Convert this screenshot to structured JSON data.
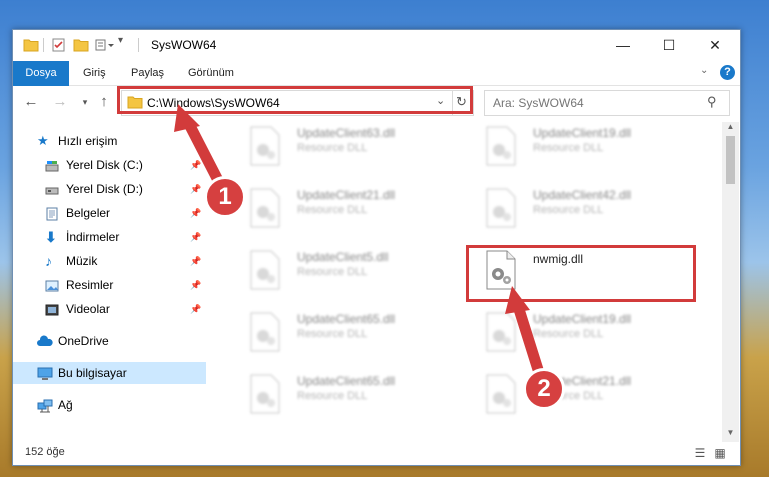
{
  "window": {
    "title": "SysWOW64",
    "controls": {
      "minimize": "—",
      "maximize": "☐",
      "close": "✕"
    }
  },
  "ribbon": {
    "tabs": [
      "Dosya",
      "Giriş",
      "Paylaş",
      "Görünüm"
    ],
    "help": "?"
  },
  "address_bar": {
    "path": "C:\\Windows\\SysWOW64",
    "search_placeholder": "Ara: SysWOW64"
  },
  "sidebar": {
    "items": [
      {
        "label": "Hızlı erişim",
        "icon": "star-icon",
        "pinned": false
      },
      {
        "label": "Yerel Disk (C:)",
        "icon": "drive-icon",
        "pinned": true
      },
      {
        "label": "Yerel Disk (D:)",
        "icon": "drive-icon",
        "pinned": true
      },
      {
        "label": "Belgeler",
        "icon": "documents-icon",
        "pinned": true
      },
      {
        "label": "İndirmeler",
        "icon": "download-icon",
        "pinned": true
      },
      {
        "label": "Müzik",
        "icon": "music-icon",
        "pinned": true
      },
      {
        "label": "Resimler",
        "icon": "pictures-icon",
        "pinned": true
      },
      {
        "label": "Videolar",
        "icon": "videos-icon",
        "pinned": true
      },
      {
        "label": "OneDrive",
        "icon": "cloud-icon",
        "pinned": false
      },
      {
        "label": "Bu bilgisayar",
        "icon": "computer-icon",
        "pinned": false
      },
      {
        "label": "Ağ",
        "icon": "network-icon",
        "pinned": false
      }
    ]
  },
  "files": [
    {
      "name": "UpdateClient63.dll",
      "type": "Resource DLL"
    },
    {
      "name": "UpdateClient19.dll",
      "type": "Resource DLL"
    },
    {
      "name": "UpdateClient21.dll",
      "type": "Resource DLL"
    },
    {
      "name": "UpdateClient42.dll",
      "type": "Resource DLL"
    },
    {
      "name": "UpdateClient5.dll",
      "type": "Resource DLL"
    },
    {
      "name": "nwmig.dll",
      "type": ""
    },
    {
      "name": "UpdateClient65.dll",
      "type": "Resource DLL"
    },
    {
      "name": "UpdateClient19.dll",
      "type": "Resource DLL"
    },
    {
      "name": "UpdateClient65.dll",
      "type": "Resource DLL"
    },
    {
      "name": "UpdateClient21.dll",
      "type": "Resource DLL"
    }
  ],
  "status": {
    "count": "152 öğe"
  },
  "annotations": {
    "step1": "1",
    "step2": "2",
    "color": "#d23b3b"
  },
  "colors": {
    "accent": "#1979ca",
    "selected": "#cce8ff",
    "highlight": "#d23b3b"
  }
}
